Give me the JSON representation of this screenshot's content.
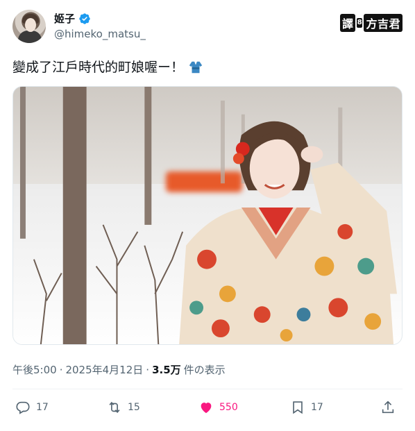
{
  "author": {
    "display_name": "姬子",
    "handle": "@himeko_matsu_",
    "verified_icon": "verified-badge-icon",
    "avatar_icon": "avatar"
  },
  "watermark": {
    "part1": "譯",
    "sep": "8",
    "part2": "方吉君"
  },
  "tweet": {
    "text": "變成了江戶時代的町娘喔ー！",
    "emoji_icon": "kimono-icon"
  },
  "meta": {
    "time": "午後5:00",
    "sep1": "·",
    "date": "2025年4月12日",
    "sep2": "·",
    "views_count": "3.5万",
    "views_label": "件の表示"
  },
  "actions": {
    "replies": "17",
    "retweets": "15",
    "likes": "550",
    "bookmarks": "17"
  },
  "colors": {
    "text": "#0f1419",
    "secondary": "#536471",
    "like": "#f91880",
    "verified": "#1d9bf0"
  }
}
